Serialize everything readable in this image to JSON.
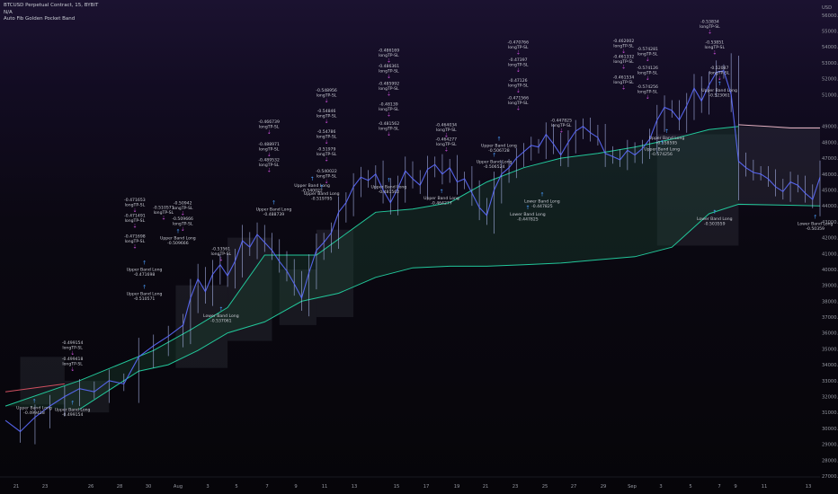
{
  "legend": {
    "symbol": "BTCUSD Perpetual Contract, 15, BYBIT",
    "indicator_1": "N/A",
    "indicator_2": "Auto Fib Golden Pocket Band"
  },
  "colors": {
    "candle": "#b8c6ff",
    "price_line": "#5c6bff",
    "green_band": "#22c79a",
    "red_band": "#d05060",
    "pink_line": "#e3b0c0",
    "box_fill": "#7b8090",
    "band_fill": "#1e4a35",
    "long_marker": "#4a9eff",
    "sl_marker": "#d24fe0"
  },
  "chart_data": {
    "type": "line",
    "title": "",
    "xlabel": "",
    "ylabel": "",
    "x_ticks": [
      "21",
      "23",
      "26",
      "28",
      "30",
      "Aug",
      "3",
      "5",
      "7",
      "9",
      "11",
      "13",
      "15",
      "17",
      "19",
      "21",
      "23",
      "25",
      "27",
      "29",
      "Sep",
      "3",
      "5",
      "7",
      "9",
      "11",
      "13"
    ],
    "y_ticks": [
      "56000.0",
      "55000.0",
      "54000.0",
      "53000.0",
      "52000.0",
      "51000.0",
      "49000.0",
      "48000.0",
      "47000.0",
      "46000.0",
      "45000.0",
      "44000.0",
      "43000.0",
      "42000.0",
      "41000.0",
      "40000.0",
      "39000.0",
      "38000.0",
      "37000.0",
      "36000.0",
      "35000.0",
      "34000.0",
      "33000.0",
      "32000.0",
      "31000.0",
      "30000.0",
      "29000.0",
      "28000.0",
      "27000.0"
    ],
    "y_top_label": "USD",
    "ylim": [
      27000,
      56500
    ],
    "series": [
      {
        "type": "price",
        "points": [
          [
            0,
            30500
          ],
          [
            2,
            29800
          ],
          [
            4,
            30700
          ],
          [
            6,
            31400
          ],
          [
            8,
            32000
          ],
          [
            10,
            32500
          ],
          [
            12,
            32300
          ],
          [
            14,
            33000
          ],
          [
            16,
            32800
          ],
          [
            18,
            34500
          ],
          [
            20,
            35200
          ],
          [
            22,
            35800
          ],
          [
            24,
            36500
          ],
          [
            25,
            38200
          ],
          [
            26,
            39400
          ],
          [
            27,
            38600
          ],
          [
            28,
            39700
          ],
          [
            29,
            40300
          ],
          [
            30,
            39600
          ],
          [
            31,
            40500
          ],
          [
            32,
            41800
          ],
          [
            33,
            41400
          ],
          [
            34,
            42200
          ],
          [
            35,
            41700
          ],
          [
            36,
            41200
          ],
          [
            37,
            40500
          ],
          [
            38,
            39900
          ],
          [
            39,
            39100
          ],
          [
            40,
            38200
          ],
          [
            41,
            39800
          ],
          [
            42,
            41200
          ],
          [
            43,
            41700
          ],
          [
            44,
            42300
          ],
          [
            45,
            43600
          ],
          [
            46,
            44200
          ],
          [
            47,
            45200
          ],
          [
            48,
            45800
          ],
          [
            49,
            45600
          ],
          [
            50,
            46000
          ],
          [
            51,
            45000
          ],
          [
            52,
            44200
          ],
          [
            53,
            45100
          ],
          [
            54,
            46200
          ],
          [
            55,
            45700
          ],
          [
            56,
            45300
          ],
          [
            57,
            46300
          ],
          [
            58,
            46600
          ],
          [
            59,
            46000
          ],
          [
            60,
            46400
          ],
          [
            61,
            45500
          ],
          [
            62,
            45700
          ],
          [
            63,
            44800
          ],
          [
            64,
            43900
          ],
          [
            65,
            43400
          ],
          [
            66,
            45000
          ],
          [
            67,
            46000
          ],
          [
            68,
            46400
          ],
          [
            69,
            47000
          ],
          [
            70,
            47400
          ],
          [
            71,
            47800
          ],
          [
            72,
            47700
          ],
          [
            73,
            48500
          ],
          [
            74,
            47900
          ],
          [
            75,
            47200
          ],
          [
            76,
            48000
          ],
          [
            77,
            48700
          ],
          [
            78,
            49000
          ],
          [
            79,
            48600
          ],
          [
            80,
            48300
          ],
          [
            81,
            47300
          ],
          [
            82,
            47100
          ],
          [
            83,
            46900
          ],
          [
            84,
            47500
          ],
          [
            85,
            47200
          ],
          [
            86,
            47600
          ],
          [
            87,
            48200
          ],
          [
            88,
            49400
          ],
          [
            89,
            50200
          ],
          [
            90,
            50000
          ],
          [
            91,
            49400
          ],
          [
            92,
            50300
          ],
          [
            93,
            51400
          ],
          [
            94,
            50600
          ],
          [
            95,
            51600
          ],
          [
            96,
            52400
          ],
          [
            97,
            52500
          ],
          [
            98,
            51000
          ],
          [
            99,
            46800
          ],
          [
            100,
            46400
          ],
          [
            101,
            46100
          ],
          [
            102,
            46000
          ],
          [
            103,
            45700
          ],
          [
            104,
            45200
          ],
          [
            105,
            44900
          ],
          [
            106,
            45500
          ],
          [
            107,
            45300
          ],
          [
            108,
            44800
          ],
          [
            109,
            44400
          ],
          [
            110,
            45800
          ]
        ]
      },
      {
        "type": "green_band_upper",
        "points": [
          [
            0,
            31400
          ],
          [
            10,
            33000
          ],
          [
            20,
            34900
          ],
          [
            25,
            36200
          ],
          [
            30,
            37600
          ],
          [
            35,
            40900
          ],
          [
            42,
            40900
          ],
          [
            50,
            43600
          ],
          [
            55,
            43800
          ],
          [
            60,
            44200
          ],
          [
            65,
            45500
          ],
          [
            70,
            46400
          ],
          [
            75,
            47000
          ],
          [
            80,
            47300
          ],
          [
            85,
            47700
          ],
          [
            90,
            48200
          ],
          [
            95,
            48800
          ],
          [
            99,
            49000
          ]
        ]
      },
      {
        "type": "green_band_lower",
        "points": [
          [
            10,
            31200
          ],
          [
            14,
            32400
          ],
          [
            18,
            33600
          ],
          [
            22,
            34000
          ],
          [
            26,
            34900
          ],
          [
            30,
            36000
          ],
          [
            35,
            36700
          ],
          [
            40,
            38000
          ],
          [
            45,
            38500
          ],
          [
            50,
            39500
          ],
          [
            55,
            40100
          ],
          [
            60,
            40200
          ],
          [
            65,
            40200
          ],
          [
            70,
            40300
          ],
          [
            75,
            40400
          ],
          [
            80,
            40600
          ],
          [
            85,
            40800
          ],
          [
            90,
            41400
          ],
          [
            95,
            43500
          ],
          [
            99,
            44100
          ],
          [
            110,
            44000
          ]
        ]
      },
      {
        "type": "pink_upper",
        "points": [
          [
            99,
            49100
          ],
          [
            103,
            49000
          ],
          [
            106,
            48900
          ],
          [
            110,
            48900
          ]
        ]
      }
    ]
  },
  "signals": [
    {
      "kind": "sl",
      "value": "-0.499154",
      "text": "longTP-SL"
    },
    {
      "kind": "sl",
      "value": "-0.499418",
      "text": "longTP-SL"
    },
    {
      "kind": "long",
      "text": "Upper Band Long",
      "value": "-0.499418"
    },
    {
      "kind": "long",
      "text": "Upper Band Long",
      "value": "-0.499154"
    },
    {
      "kind": "sl",
      "value": "-0.471653",
      "text": "longTP-SL"
    },
    {
      "kind": "sl",
      "value": "-0.471491",
      "text": "longTP-SL"
    },
    {
      "kind": "sl",
      "value": "-0.471698",
      "text": "longTP-SL"
    },
    {
      "kind": "long",
      "text": "Upper Band Long",
      "value": "-0.510571"
    },
    {
      "kind": "long",
      "text": "Upper Band Long",
      "value": "-0.471698"
    },
    {
      "kind": "sl",
      "value": "-0.510571",
      "text": "longTP-SL"
    },
    {
      "kind": "sl",
      "value": "-0.50942",
      "text": "longTP-SL"
    },
    {
      "kind": "sl",
      "value": "-0.509666",
      "text": "longTP-SL"
    },
    {
      "kind": "long",
      "text": "Upper Band Long",
      "value": "-0.509666"
    },
    {
      "kind": "sl",
      "value": "-0.53561",
      "text": "longTP-SL"
    },
    {
      "kind": "long",
      "text": "Lower Band Long",
      "value": "-0.537061"
    },
    {
      "kind": "sl",
      "value": "-0.466739",
      "text": "longTP-SL"
    },
    {
      "kind": "sl",
      "value": "-0.488971",
      "text": "longTP-SL"
    },
    {
      "kind": "sl",
      "value": "-0.489532",
      "text": "longTP-SL"
    },
    {
      "kind": "long",
      "text": "Upper Band Long",
      "value": "-0.488739"
    },
    {
      "kind": "sl",
      "value": "-0.548956",
      "text": "longTP-SL"
    },
    {
      "kind": "sl",
      "value": "-0.54846",
      "text": "longTP-SL"
    },
    {
      "kind": "sl",
      "value": "-0.54786",
      "text": "longTP-SL"
    },
    {
      "kind": "sl",
      "value": "-0.51979",
      "text": "longTP-SL"
    },
    {
      "kind": "sl",
      "value": "-0.540022",
      "text": "longTP-SL"
    },
    {
      "kind": "long",
      "text": "Upper Band Long",
      "value": "-0.540022"
    },
    {
      "kind": "long",
      "text": "Upper Band Long",
      "value": "-0.519795"
    },
    {
      "kind": "sl",
      "value": "-0.486169",
      "text": "longTP-SL"
    },
    {
      "kind": "sl",
      "value": "-0.486361",
      "text": "longTP-SL"
    },
    {
      "kind": "sl",
      "value": "-0.485992",
      "text": "longTP-SL"
    },
    {
      "kind": "sl",
      "value": "-0.48139",
      "text": "longTP-SL"
    },
    {
      "kind": "sl",
      "value": "-0.481562",
      "text": "longTP-SL"
    },
    {
      "kind": "long",
      "text": "Upper Band Long",
      "value": "-0.481562"
    },
    {
      "kind": "sl",
      "value": "-0.464034",
      "text": "longTP-SL"
    },
    {
      "kind": "sl",
      "value": "-0.464277",
      "text": "longTP-SL"
    },
    {
      "kind": "long",
      "text": "Upper Band Long",
      "value": "-0.464277"
    },
    {
      "kind": "sl",
      "value": "-0.470766",
      "text": "longTP-SL"
    },
    {
      "kind": "sl",
      "value": "-0.47397",
      "text": "longTP-SL"
    },
    {
      "kind": "sl",
      "value": "-0.47126",
      "text": "longTP-SL"
    },
    {
      "kind": "sl",
      "value": "-0.471566",
      "text": "longTP-SL"
    },
    {
      "kind": "long",
      "text": "Upper Band Long",
      "value": "-0.506728"
    },
    {
      "kind": "long",
      "text": "Upper Band Long",
      "value": "-0.506524"
    },
    {
      "kind": "sl",
      "value": "-0.447825",
      "text": "longTP-SL"
    },
    {
      "kind": "long",
      "text": "Lower Band Long",
      "value": "-0.447825"
    },
    {
      "kind": "long",
      "text": "Lower Band Long",
      "value": "-0.447825"
    },
    {
      "kind": "sl",
      "value": "-0.462002",
      "text": "longTP-SL"
    },
    {
      "kind": "sl",
      "value": "-0.461332",
      "text": "longTP-SL"
    },
    {
      "kind": "sl",
      "value": "-0.461534",
      "text": "longTP-SL"
    },
    {
      "kind": "sl",
      "value": "-0.574281",
      "text": "longTP-SL"
    },
    {
      "kind": "sl",
      "value": "-0.574126",
      "text": "longTP-SL"
    },
    {
      "kind": "sl",
      "value": "-0.574256",
      "text": "longTP-SL"
    },
    {
      "kind": "long",
      "text": "Upper Band Long",
      "value": "-0.558595"
    },
    {
      "kind": "long",
      "text": "Upper Band Long",
      "value": "-0.574256"
    },
    {
      "kind": "sl",
      "value": "-0.53834",
      "text": "longTP-SL"
    },
    {
      "kind": "sl",
      "value": "-0.53851",
      "text": "longTP-SL"
    },
    {
      "kind": "sl",
      "value": "-0.52087",
      "text": "longTP-SL"
    },
    {
      "kind": "long",
      "text": "Upper Band Long",
      "value": "-0.523061"
    },
    {
      "kind": "long",
      "text": "Lower Band Long",
      "value": "-0.503559"
    },
    {
      "kind": "long",
      "text": "Lower Band Long",
      "value": "-0.50359"
    }
  ]
}
